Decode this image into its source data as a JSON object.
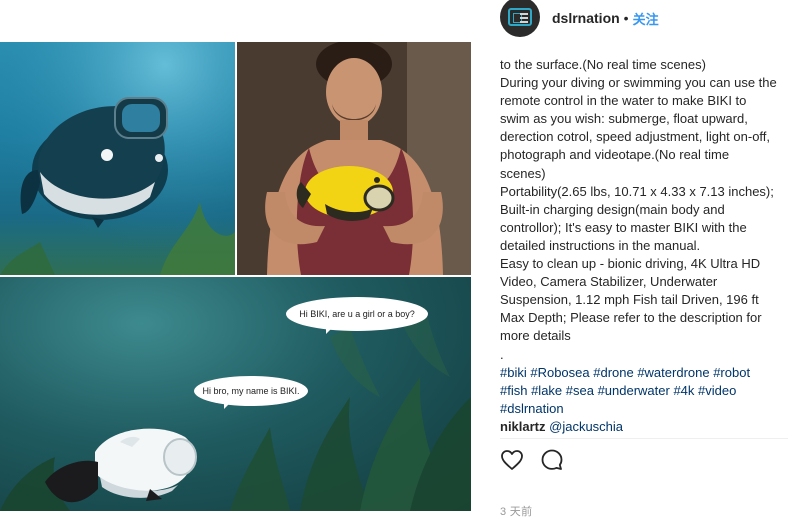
{
  "post": {
    "author": {
      "username": "dslrnation",
      "separator": "•",
      "follow_label": "关注",
      "avatar_icon": "dslr-nation-logo"
    },
    "image": {
      "bubble_1": "Hi BIKI, are u a girl or a boy?",
      "bubble_2": "Hi bro, my name is BIKI."
    },
    "caption": {
      "lines": [
        "to the surface.(No real time scenes)",
        "During your diving or swimming you can use the remote control in the water to make BIKI to swim as you wish: submerge, float upward, derection cotrol, speed adjustment, light on-off, photograph and videotape.(No real time scenes)",
        "Portability(2.65 lbs, 10.71 x 4.33 x 7.13 inches); Built-in charging design(main body and controllor); It's easy to master BIKI with the detailed instructions in the manual.",
        "Easy to clean up - bionic driving, 4K Ultra HD Video, Camera Stabilizer, Underwater Suspension, 1.12 mph Fish tail Driven, 196 ft Max Depth; Please refer to the description for more details",
        "."
      ],
      "hashtags": "#biki #Robosea #drone #waterdrone #robot #fish #lake #sea #underwater #4k #video #dslrnation"
    },
    "comment": {
      "user": "niklartz",
      "mention": "@jackuschia"
    },
    "actions": {
      "like_icon": "heart-icon",
      "comment_icon": "comment-icon"
    },
    "timestamp": "3 天前",
    "colors": {
      "link": "#3897f0",
      "hashtag": "#003569",
      "muted": "#999999"
    }
  }
}
